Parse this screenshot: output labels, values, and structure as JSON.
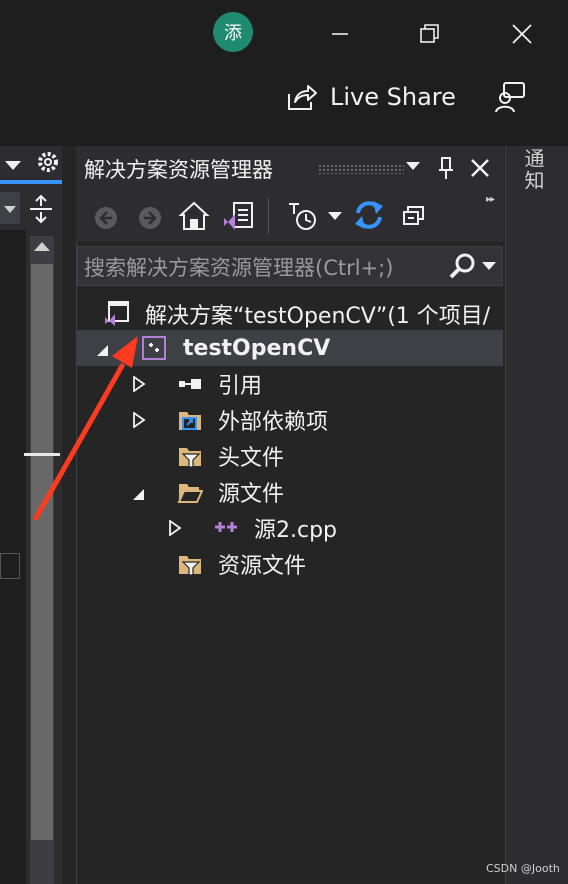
{
  "titlebar": {
    "avatar_char": "添"
  },
  "toolbar_top": {
    "live_share_label": "Live Share"
  },
  "notifications": {
    "label": "通知"
  },
  "solution_explorer": {
    "title": "解决方案资源管理器",
    "search_placeholder": "搜索解决方案资源管理器(Ctrl+;)",
    "tree": {
      "solution": "解决方案“testOpenCV”(1 个项目/",
      "project": "testOpenCV",
      "references": "引用",
      "external_deps": "外部依赖项",
      "header_files": "头文件",
      "source_files": "源文件",
      "source_file_1": "源2.cpp",
      "resource_files": "资源文件"
    }
  },
  "watermark": "CSDN @Jooth",
  "colors": {
    "accent": "#3794ff",
    "vs_purple": "#b180d7",
    "folder": "#dcb67a",
    "arrow": "#ff3b1f"
  }
}
